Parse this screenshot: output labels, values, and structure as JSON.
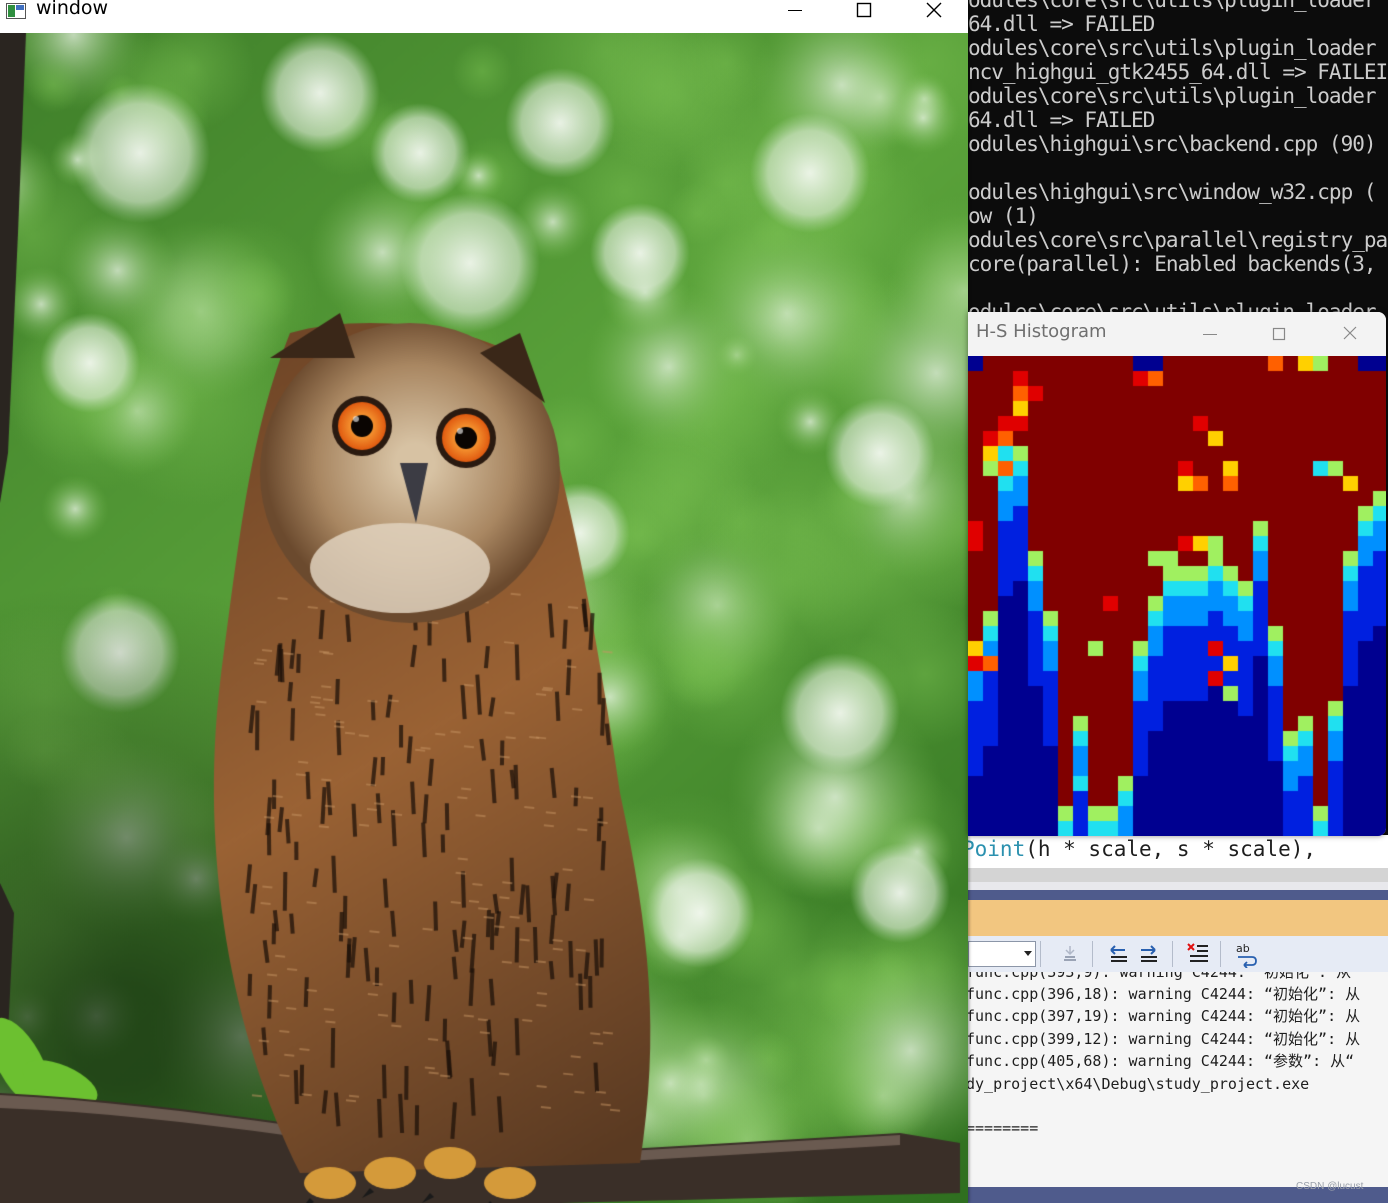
{
  "image_window": {
    "title": "window",
    "icon": "app-window-icon",
    "controls": [
      "minimize-icon",
      "maximize-icon",
      "close-icon"
    ]
  },
  "console": {
    "lines": [
      "odules\\core\\src\\utils\\plugin_loader",
      "64.dll => FAILED",
      "odules\\core\\src\\utils\\plugin_loader",
      "ncv_highgui_gtk2455_64.dll => FAILEI",
      "odules\\core\\src\\utils\\plugin_loader",
      "64.dll => FAILED",
      "odules\\highgui\\src\\backend.cpp (90)",
      "",
      "odules\\highgui\\src\\window_w32.cpp (",
      "ow (1)",
      "odules\\core\\src\\parallel\\registry_pa",
      "core(parallel): Enabled backends(3,",
      "",
      "odules\\core\\src\\utils\\plugin_loader"
    ]
  },
  "histogram_window": {
    "title": "H-S Histogram",
    "controls": [
      "minimize-icon",
      "maximize-icon",
      "close-icon"
    ],
    "colors": {
      "dark_red": "#800000",
      "red": "#e00000",
      "orange": "#ff6000",
      "yellow": "#ffd000",
      "lime": "#a0f060",
      "cyan": "#20e0f0",
      "light_blue": "#0090ff",
      "blue": "#0020e0",
      "dark_blue": "#000090"
    }
  },
  "editor": {
    "code_line": {
      "type": "Point",
      "args": "(h * scale, s * scale),"
    }
  },
  "output_toolbar": {
    "source_value": "",
    "buttons": [
      "clear-all-icon",
      "go-to-prev-message-icon",
      "go-to-next-message-icon",
      "clear-output-icon",
      "toggle-word-wrap-icon"
    ]
  },
  "output_log": {
    "lines": [
      "func.cpp(393,9): warning C4244: “初始化”: 从",
      "func.cpp(396,18): warning C4244: “初始化”: 从",
      "func.cpp(397,19): warning C4244: “初始化”: 从",
      "func.cpp(399,12): warning C4244: “初始化”: 从",
      "func.cpp(405,68): warning C4244: “参数”: 从“",
      "dy_project\\x64\\Debug\\study_project.exe",
      "",
      "========"
    ]
  },
  "watermark": "CSDN @lucust"
}
